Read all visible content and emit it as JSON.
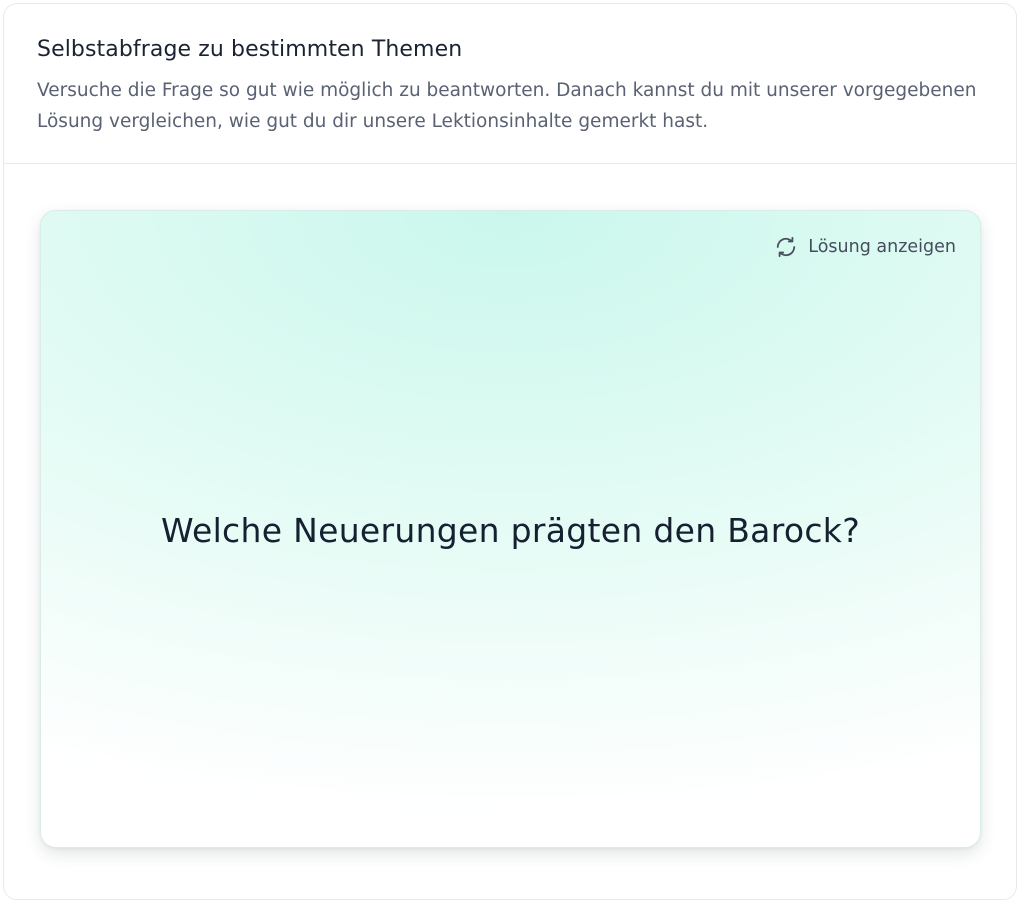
{
  "header": {
    "title": "Selbstabfrage zu bestimmten Themen",
    "description": "Versuche die Frage so gut wie möglich zu beantworten. Danach kannst du mit unserer vorgegebenen Lösung vergleichen, wie gut du dir unsere Lektionsinhalte gemerkt hast."
  },
  "flashcard": {
    "toggle_label": "Lösung anzeigen",
    "toggle_icon": "refresh-icon",
    "question": "Welche Neuerungen prägten den Barock?"
  },
  "colors": {
    "card_gradient_top": "#caf7ec",
    "card_gradient_bottom": "#ffffff",
    "title_text": "#1b2333",
    "body_text": "#596173"
  }
}
